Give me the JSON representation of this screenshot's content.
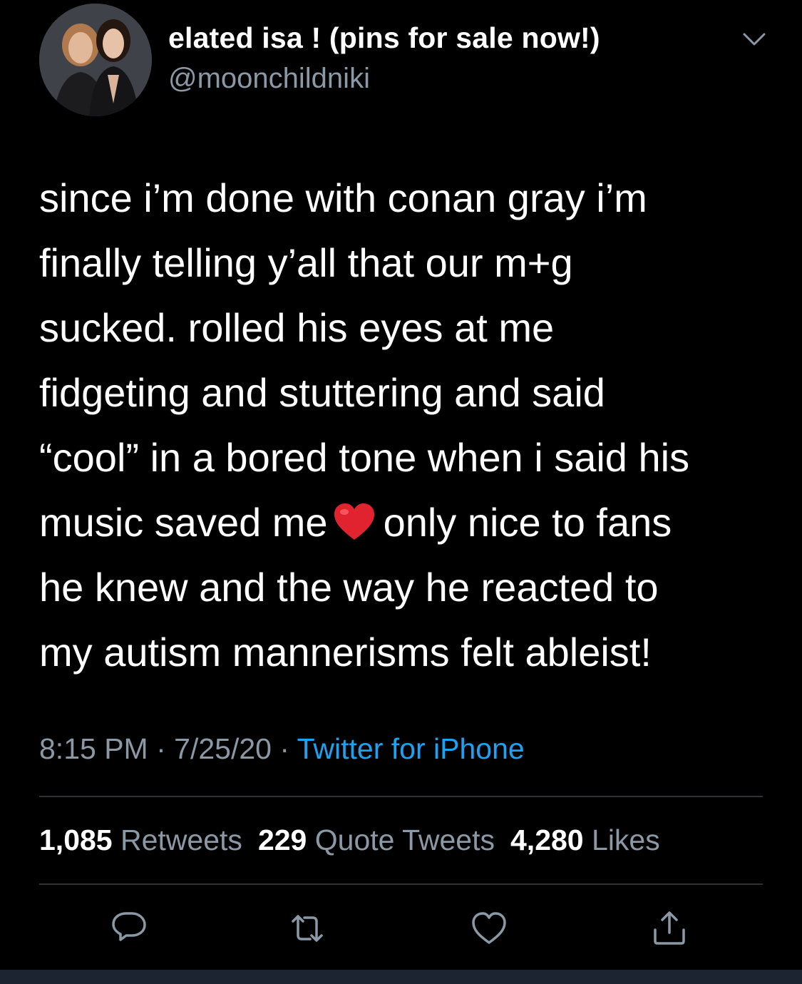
{
  "user": {
    "display_name": "elated isa ! (pins for sale now!)",
    "handle": "@moonchildniki",
    "avatar_icon": "profile-photo"
  },
  "tweet": {
    "lines": [
      "since i’m done with conan gray i’m",
      "finally telling y’all that our m+g",
      "sucked. rolled his eyes at me",
      "fidgeting and stuttering and said",
      "“cool” in a bored tone when i said his",
      "music saved me",
      "only nice to fans",
      "he knew and the way he reacted to",
      "my autism mannerisms felt ableist!"
    ],
    "emoji": "red-heart"
  },
  "meta": {
    "time": "8:15 PM",
    "separator": " · ",
    "date": "7/25/20",
    "source": "Twitter for iPhone"
  },
  "stats": {
    "retweets_count": "1,085",
    "retweets_label": "Retweets",
    "quotes_count": "229",
    "quotes_label": "Quote Tweets",
    "likes_count": "4,280",
    "likes_label": "Likes"
  },
  "actions": {
    "icons": [
      "reply-icon",
      "retweet-icon",
      "like-icon",
      "share-icon"
    ]
  },
  "colors": {
    "background": "#000000",
    "text": "#ffffff",
    "secondary": "#8b98a5",
    "link": "#1da1f2",
    "divider": "#2f3336",
    "heart": "#e0232e"
  }
}
